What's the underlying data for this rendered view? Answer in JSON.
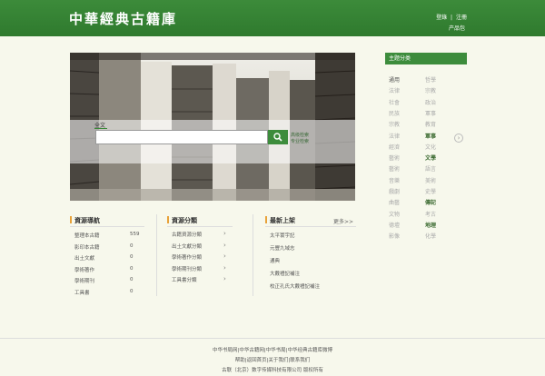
{
  "header": {
    "logo": "中華經典古籍庫",
    "login": "登錄",
    "separator": "|",
    "register": "注冊",
    "app": "产品包"
  },
  "search": {
    "tab_fulltext": "全文",
    "input_value": "",
    "advanced": "高级检索",
    "professional": "专业检索"
  },
  "sidebar": {
    "title": "主题分类",
    "col1": [
      {
        "label": "通用",
        "style": "dark"
      },
      {
        "label": "法律",
        "style": "normal"
      },
      {
        "label": "社會",
        "style": "normal"
      },
      {
        "label": "民族",
        "style": "normal"
      },
      {
        "label": "宗教",
        "style": "normal"
      },
      {
        "label": "法律",
        "style": "normal"
      },
      {
        "label": "經濟",
        "style": "normal"
      },
      {
        "label": "藝術",
        "style": "normal"
      },
      {
        "label": "藝術",
        "style": "normal"
      },
      {
        "label": "音樂",
        "style": "normal"
      },
      {
        "label": "戲劇",
        "style": "normal"
      },
      {
        "label": "曲藝",
        "style": "normal"
      },
      {
        "label": "文物",
        "style": "normal"
      },
      {
        "label": "德壇",
        "style": "normal"
      },
      {
        "label": "影像",
        "style": "normal"
      }
    ],
    "col2": [
      {
        "label": "哲學",
        "style": "normal"
      },
      {
        "label": "宗教",
        "style": "normal"
      },
      {
        "label": "政治",
        "style": "normal"
      },
      {
        "label": "軍事",
        "style": "normal"
      },
      {
        "label": "教育",
        "style": "normal"
      },
      {
        "label": "軍事",
        "style": "bold"
      },
      {
        "label": "文化",
        "style": "normal"
      },
      {
        "label": "文學",
        "style": "bold"
      },
      {
        "label": "語言",
        "style": "normal"
      },
      {
        "label": "美術",
        "style": "normal"
      },
      {
        "label": "史學",
        "style": "normal"
      },
      {
        "label": "傳記",
        "style": "bold"
      },
      {
        "label": "考古",
        "style": "normal"
      },
      {
        "label": "地理",
        "style": "bold"
      },
      {
        "label": "化學",
        "style": "normal"
      }
    ]
  },
  "panels": {
    "nav": {
      "title": "資源導航",
      "rows": [
        {
          "label": "整理本古籍",
          "count": "559"
        },
        {
          "label": "影印本古籍",
          "count": "0"
        },
        {
          "label": "出土文獻",
          "count": "0"
        },
        {
          "label": "學術著作",
          "count": "0"
        },
        {
          "label": "學術期刊",
          "count": "0"
        },
        {
          "label": "工具書",
          "count": "0"
        }
      ]
    },
    "cats": {
      "title": "資源分類",
      "rows": [
        {
          "label": "古籍資源分類"
        },
        {
          "label": "出土文獻分類"
        },
        {
          "label": "學術著作分類"
        },
        {
          "label": "學術期刊分類"
        },
        {
          "label": "工具書分類"
        }
      ]
    },
    "latest": {
      "title": "最新上架",
      "more": "更多>>",
      "rows": [
        {
          "label": "太平寰宇記"
        },
        {
          "label": "元豐九域志"
        },
        {
          "label": "通典"
        },
        {
          "label": "大戴禮記補注"
        },
        {
          "label": "校正孔氏大戴禮記補注"
        }
      ]
    }
  },
  "footer": {
    "line1": "中华书局网|中华古籍网|中华书局|中华经典古籍库微博",
    "line2": "帮助|返回首页|关于我们|联系我们",
    "line3": "古联（北京）数字传媒科技有限公司  版权所有"
  },
  "colors": {
    "header": "#3c8b3a",
    "accent": "#3d8c3c",
    "panel_marker": "#e8a23a",
    "background": "#f7f8ec"
  }
}
